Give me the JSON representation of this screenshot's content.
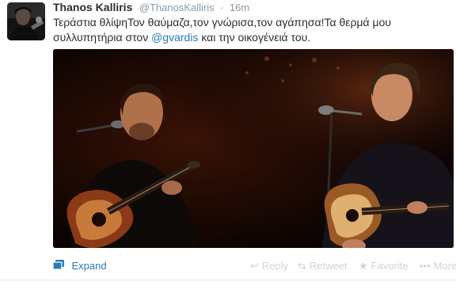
{
  "tweet": {
    "fullname": "Thanos Kalliris",
    "username": "@ThanosKalliris",
    "separator": "·",
    "time": "16m",
    "text_part1": "Τεράστια θλίψηΤον θαύμαζα,τον γνώρισα,τον αγάπησα!Τα θερμά μου συλλυπητήρια στον ",
    "mention": "@gvardis",
    "text_part2": " και την οικογένειά του."
  },
  "footer": {
    "expand_label": "Expand",
    "reply_label": "Reply",
    "retweet_label": "Retweet",
    "favorite_label": "Favorite",
    "more_label": "More",
    "reply_icon": "reply-icon",
    "retweet_icon": "retweet-icon",
    "favorite_icon": "star-icon",
    "more_icon": "more-icon",
    "expand_icon": "media-icon"
  },
  "colors": {
    "link": "#2b7bb9",
    "muted": "#8899a6",
    "action_inactive": "#ccd6dd",
    "text": "#292f33"
  }
}
